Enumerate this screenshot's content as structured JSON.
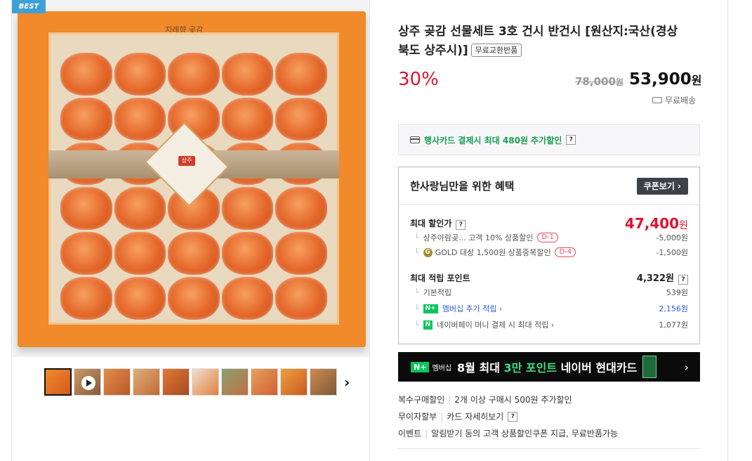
{
  "badge": "BEST",
  "product": {
    "title_line1": "상주 곶감 선물세트 3호 건시 반건시 [원산지:국산(경상",
    "title_line2": "북도 상주시)]",
    "free_exchange_tag": "무료교환반품",
    "box_lid_text": "지례향 곶감",
    "band_seal_text": "상주",
    "discount_rate": "30%",
    "original_price": "78,000",
    "original_price_unit": "원",
    "sale_price": "53,900",
    "sale_price_unit": "원",
    "shipping": "무료배송"
  },
  "card_promo": {
    "text": "행사카드 결제시 최대 480원 추가할인",
    "help": "?"
  },
  "benefit": {
    "title": "한사랑님만을 위한 혜택",
    "coupon_button": "쿠폰보기 ›",
    "max_discount_label": "최대 할인가",
    "max_discount_help": "?",
    "max_discount_value": "47,400",
    "max_discount_unit": "원",
    "discounts": [
      {
        "label": "상주아람곶... 고객 10% 상품할인",
        "badge": "D-1",
        "value": "-5,000원"
      },
      {
        "label": "GOLD 대상 1,500원 상품중복할인",
        "badge": "D-4",
        "value": "-1,500원"
      }
    ],
    "gold_icon": "G",
    "points_label": "최대 적립 포인트",
    "points_value": "4,322원",
    "points_help": "?",
    "point_items": [
      {
        "label": "기본적립",
        "value": "539원"
      },
      {
        "label": "멤버십 추가 적립 ›",
        "value": "2,156원"
      },
      {
        "label": "네이버페이 머니 결제 시 최대 적립 ›",
        "value": "1,077원"
      }
    ],
    "npay_icon_membership": "N+",
    "npay_icon_pay": "N"
  },
  "banner": {
    "n_label": "N+",
    "membership_label": "멤버십",
    "text_pre": "8월 최대",
    "text_highlight": "3만 포인트",
    "text_post": "네이버 현대카드",
    "arrow": "›"
  },
  "extras": [
    {
      "label": "복수구매할인",
      "value": "2개 이상 구매시 500원 추가할인"
    },
    {
      "label": "무이자할부",
      "value": "카드 자세히보기",
      "help": "?"
    },
    {
      "label": "이벤트",
      "value": "알림받기 동의 고객 상품할인쿠폰 지급, 무료반품가능"
    }
  ],
  "thumbnails_next": "›",
  "colors": {
    "accent_red": "#e01432",
    "naver_green": "#03c75a",
    "link_blue": "#2c5fd6",
    "badge_blue": "#3fa0d8"
  }
}
